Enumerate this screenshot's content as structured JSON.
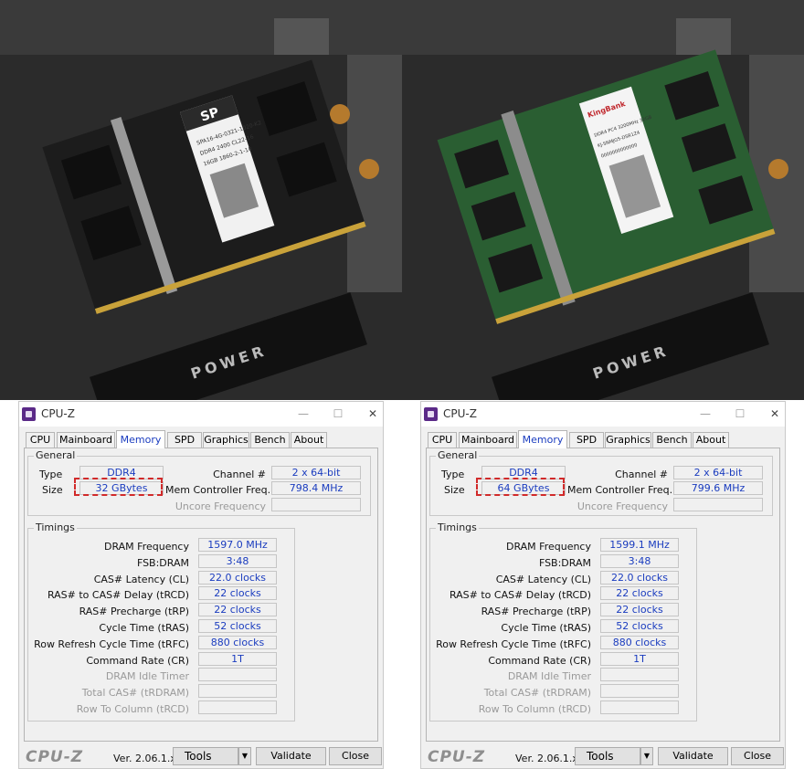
{
  "photos": {
    "left": {
      "module_brand": "SP",
      "label_lines": [
        "SPA16-4G-0321-1020-K2",
        "DDR4 2400 CL22-16",
        "16GB 1860-2-1-10"
      ],
      "board_text": "POWER",
      "pcb_color": "#1c1c1c"
    },
    "right": {
      "module_brand": "KingBank",
      "label_lines": [
        "DDR4 PC4 3200MHz 32GB",
        "KJ-SNMJG5-DSR1Z4",
        "0000000000000"
      ],
      "board_text": "POWER",
      "pcb_color": "#2a5e32"
    }
  },
  "windows": [
    {
      "id": "left",
      "title": "CPU-Z",
      "controls": {
        "minimize": "—",
        "maximize": "☐",
        "close": "✕"
      },
      "tabs": [
        "CPU",
        "Mainboard",
        "Memory",
        "SPD",
        "Graphics",
        "Bench",
        "About"
      ],
      "active_tab": "Memory",
      "general": {
        "title": "General",
        "type_label": "Type",
        "type_value": "DDR4",
        "size_label": "Size",
        "size_value": "32 GBytes",
        "channel_label": "Channel #",
        "channel_value": "2 x 64-bit",
        "mem_ctrl_label": "Mem Controller Freq.",
        "mem_ctrl_value": "798.4 MHz",
        "uncore_label": "Uncore Frequency",
        "uncore_value": ""
      },
      "timings": {
        "title": "Timings",
        "rows": [
          {
            "label": "DRAM Frequency",
            "value": "1597.0 MHz",
            "enabled": true
          },
          {
            "label": "FSB:DRAM",
            "value": "3:48",
            "enabled": true
          },
          {
            "label": "CAS# Latency (CL)",
            "value": "22.0 clocks",
            "enabled": true
          },
          {
            "label": "RAS# to CAS# Delay (tRCD)",
            "value": "22 clocks",
            "enabled": true
          },
          {
            "label": "RAS# Precharge (tRP)",
            "value": "22 clocks",
            "enabled": true
          },
          {
            "label": "Cycle Time (tRAS)",
            "value": "52 clocks",
            "enabled": true
          },
          {
            "label": "Row Refresh Cycle Time (tRFC)",
            "value": "880 clocks",
            "enabled": true
          },
          {
            "label": "Command Rate (CR)",
            "value": "1T",
            "enabled": true
          },
          {
            "label": "DRAM Idle Timer",
            "value": "",
            "enabled": false
          },
          {
            "label": "Total CAS# (tRDRAM)",
            "value": "",
            "enabled": false
          },
          {
            "label": "Row To Column (tRCD)",
            "value": "",
            "enabled": false
          }
        ]
      },
      "footer": {
        "logo": "CPU-Z",
        "version": "Ver. 2.06.1.x64",
        "tools": "Tools",
        "tools_arrow": "▼",
        "validate": "Validate",
        "close": "Close"
      }
    },
    {
      "id": "right",
      "title": "CPU-Z",
      "controls": {
        "minimize": "—",
        "maximize": "☐",
        "close": "✕"
      },
      "tabs": [
        "CPU",
        "Mainboard",
        "Memory",
        "SPD",
        "Graphics",
        "Bench",
        "About"
      ],
      "active_tab": "Memory",
      "general": {
        "title": "General",
        "type_label": "Type",
        "type_value": "DDR4",
        "size_label": "Size",
        "size_value": "64 GBytes",
        "channel_label": "Channel #",
        "channel_value": "2 x 64-bit",
        "mem_ctrl_label": "Mem Controller Freq.",
        "mem_ctrl_value": "799.6 MHz",
        "uncore_label": "Uncore Frequency",
        "uncore_value": ""
      },
      "timings": {
        "title": "Timings",
        "rows": [
          {
            "label": "DRAM Frequency",
            "value": "1599.1 MHz",
            "enabled": true
          },
          {
            "label": "FSB:DRAM",
            "value": "3:48",
            "enabled": true
          },
          {
            "label": "CAS# Latency (CL)",
            "value": "22.0 clocks",
            "enabled": true
          },
          {
            "label": "RAS# to CAS# Delay (tRCD)",
            "value": "22 clocks",
            "enabled": true
          },
          {
            "label": "RAS# Precharge (tRP)",
            "value": "22 clocks",
            "enabled": true
          },
          {
            "label": "Cycle Time (tRAS)",
            "value": "52 clocks",
            "enabled": true
          },
          {
            "label": "Row Refresh Cycle Time (tRFC)",
            "value": "880 clocks",
            "enabled": true
          },
          {
            "label": "Command Rate (CR)",
            "value": "1T",
            "enabled": true
          },
          {
            "label": "DRAM Idle Timer",
            "value": "",
            "enabled": false
          },
          {
            "label": "Total CAS# (tRDRAM)",
            "value": "",
            "enabled": false
          },
          {
            "label": "Row To Column (tRCD)",
            "value": "",
            "enabled": false
          }
        ]
      },
      "footer": {
        "logo": "CPU-Z",
        "version": "Ver. 2.06.1.x64",
        "tools": "Tools",
        "tools_arrow": "▼",
        "validate": "Validate",
        "close": "Close"
      }
    }
  ]
}
